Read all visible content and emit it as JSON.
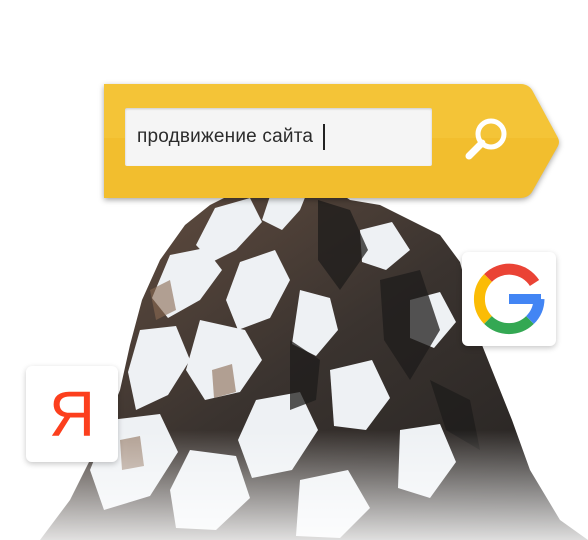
{
  "search": {
    "query": "продвижение сайта"
  },
  "engines": [
    {
      "name": "Google",
      "icon": "google-g-icon",
      "colors": [
        "#4285F4",
        "#EA4335",
        "#FBBC05",
        "#34A853"
      ]
    },
    {
      "name": "Yandex",
      "icon": "yandex-ya-icon",
      "glyph": "Я",
      "color": "#FC3F1D"
    }
  ],
  "colors": {
    "banner": "#F2BE2E",
    "banner_dark": "#E0A91C"
  }
}
